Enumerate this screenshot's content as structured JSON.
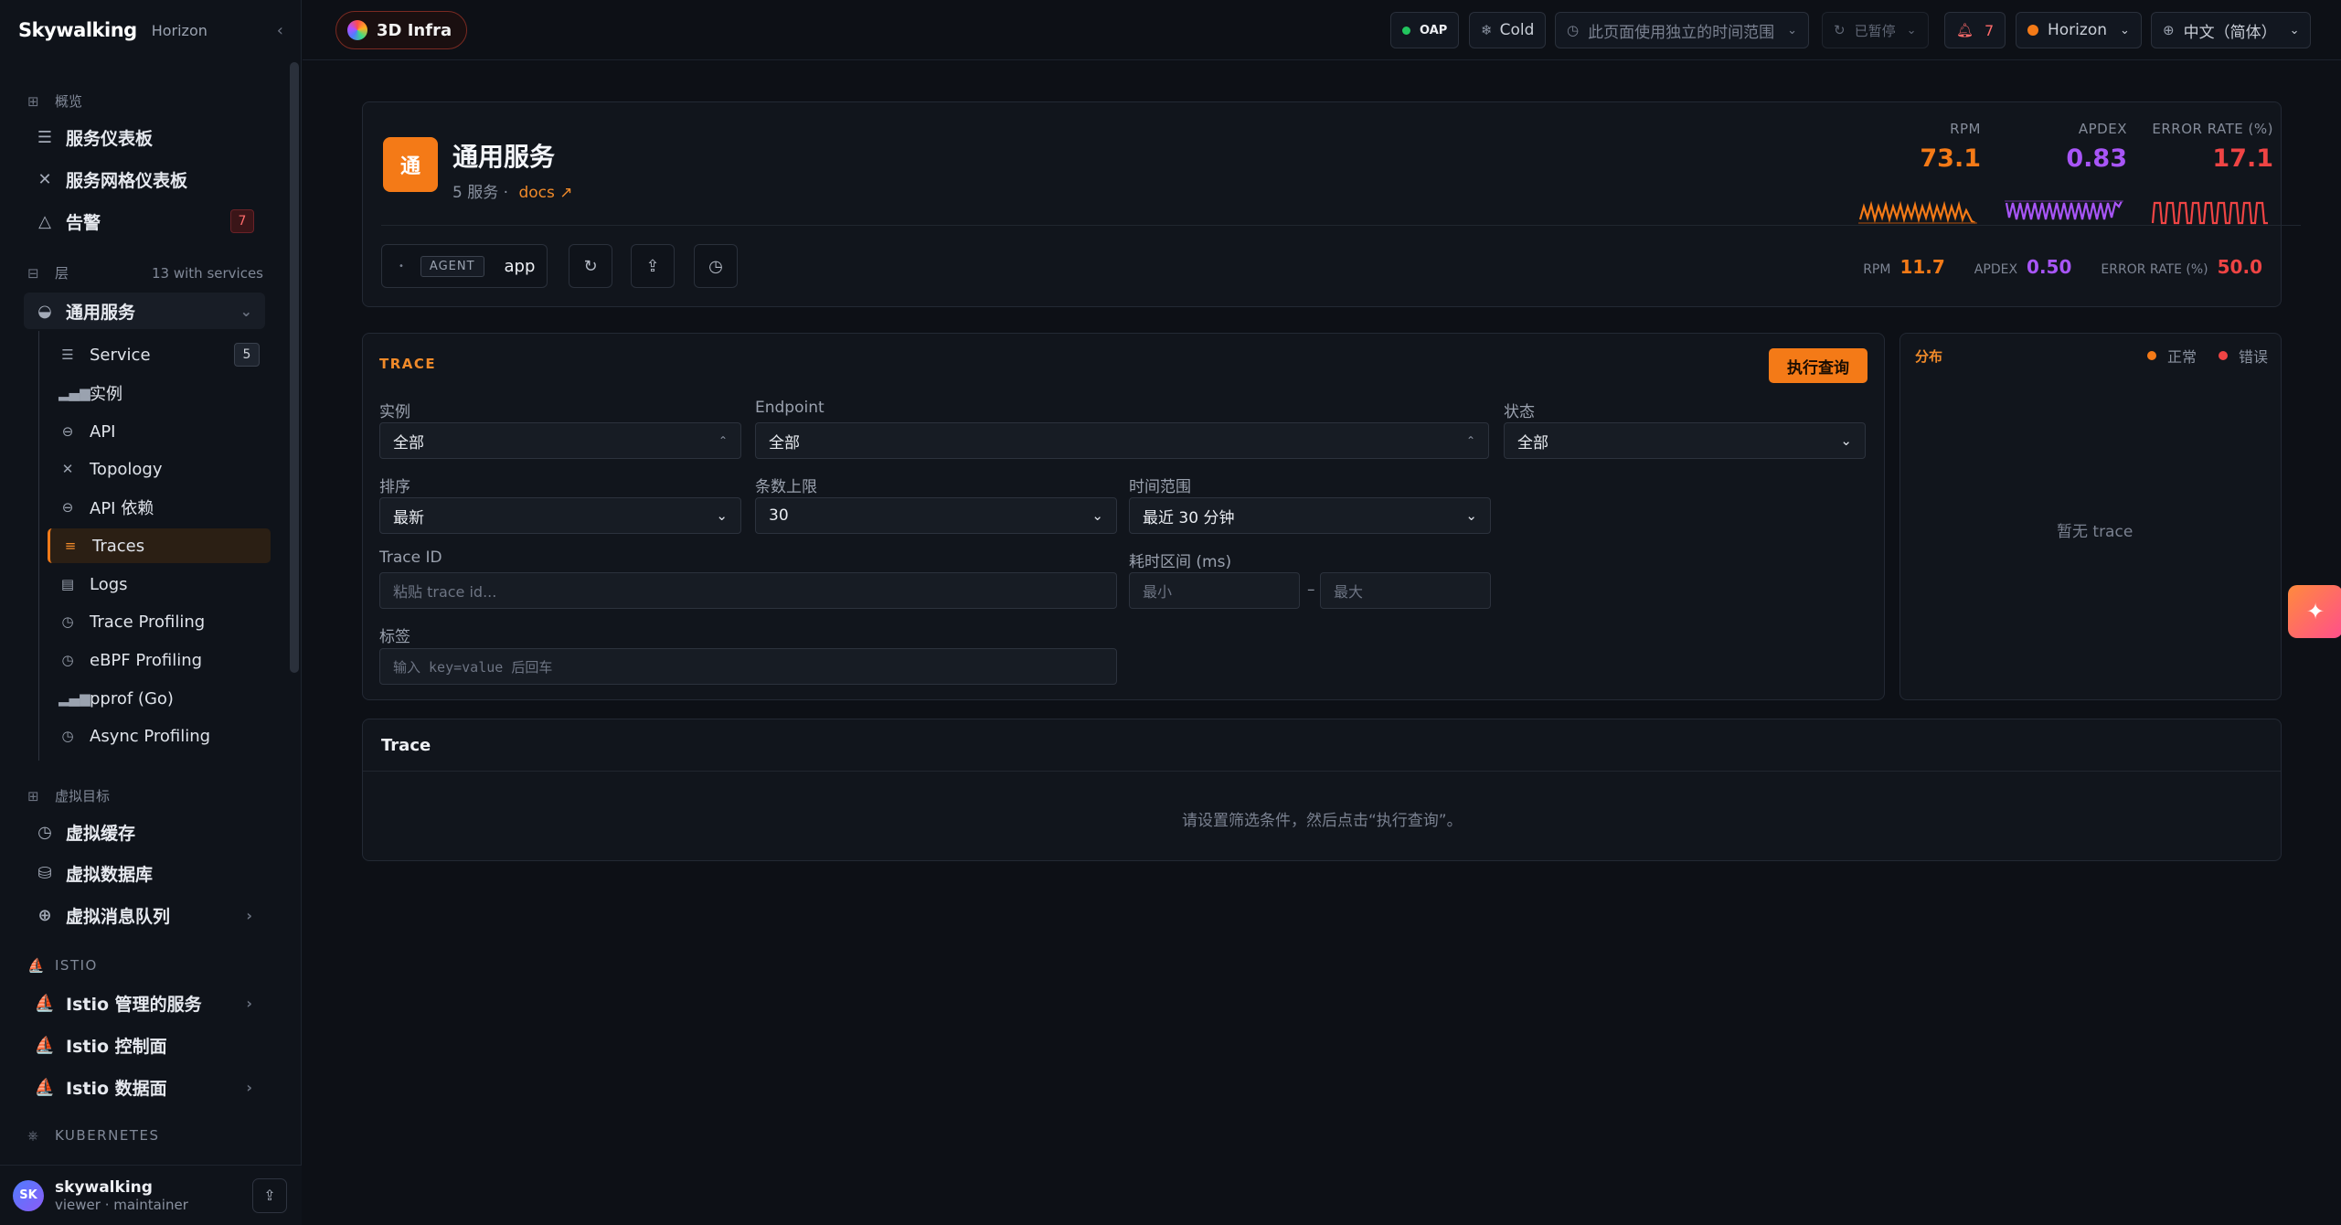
{
  "brand": {
    "logo": "Skywalking",
    "subtitle": "Horizon"
  },
  "sidebar": {
    "overview_header": "概览",
    "overview_items": [
      {
        "label": "服务仪表板"
      },
      {
        "label": "服务网格仪表板"
      },
      {
        "label": "告警",
        "badge": "7"
      }
    ],
    "layer_header": "层",
    "layer_meta": "13 with services",
    "active_group": "通用服务",
    "sub_items": [
      {
        "label": "Service",
        "count": "5"
      },
      {
        "label": "实例"
      },
      {
        "label": "API"
      },
      {
        "label": "Topology"
      },
      {
        "label": "API 依赖"
      },
      {
        "label": "Traces"
      },
      {
        "label": "Logs"
      },
      {
        "label": "Trace Profiling"
      },
      {
        "label": "eBPF Profiling"
      },
      {
        "label": "pprof (Go)"
      },
      {
        "label": "Async Profiling"
      }
    ],
    "virtual_header": "虚拟目标",
    "virtual_items": [
      {
        "label": "虚拟缓存"
      },
      {
        "label": "虚拟数据库"
      },
      {
        "label": "虚拟消息队列"
      }
    ],
    "istio_header": "ISTIO",
    "istio_items": [
      {
        "label": "Istio 管理的服务"
      },
      {
        "label": "Istio 控制面"
      },
      {
        "label": "Istio 数据面"
      }
    ],
    "k8s_header": "KUBERNETES"
  },
  "user": {
    "avatar": "SK",
    "name": "skywalking",
    "role": "viewer · maintainer"
  },
  "topbar": {
    "infra": "3D Infra",
    "oap": "OAP",
    "cold": "Cold",
    "time_range": "此页面使用独立的时间范围",
    "paused": "已暂停",
    "alerts": "7",
    "theme": "Horizon",
    "language": "中文（简体）"
  },
  "service": {
    "icon": "通",
    "title": "通用服务",
    "count_text": "5 服务 ·",
    "docs": "docs ↗",
    "metrics": [
      {
        "label": "RPM",
        "value": "73.1",
        "color": "#f47a17"
      },
      {
        "label": "APDEX",
        "value": "0.83",
        "color": "#a855f7"
      },
      {
        "label": "ERROR RATE (%)",
        "value": "17.1",
        "color": "#ef4444"
      }
    ],
    "agent_tag": "AGENT",
    "agent_value": "app",
    "mini": [
      {
        "label": "RPM",
        "value": "11.7"
      },
      {
        "label": "APDEX",
        "value": "0.50"
      },
      {
        "label": "ERROR RATE (%)",
        "value": "50.0"
      }
    ]
  },
  "trace_form": {
    "section": "TRACE",
    "run": "执行查询",
    "instance_label": "实例",
    "instance_value": "全部",
    "endpoint_label": "Endpoint",
    "endpoint_value": "全部",
    "status_label": "状态",
    "status_value": "全部",
    "sort_label": "排序",
    "sort_value": "最新",
    "limit_label": "条数上限",
    "limit_value": "30",
    "range_label": "时间范围",
    "range_value": "最近 30 分钟",
    "traceid_label": "Trace ID",
    "traceid_placeholder": "粘贴 trace id...",
    "duration_label": "耗时区间 (ms)",
    "duration_min": "最小",
    "duration_dash": "–",
    "duration_max": "最大",
    "tags_label": "标签",
    "tags_placeholder": "输入 key=value 后回车"
  },
  "distribution": {
    "title": "分布",
    "legend_normal": "正常",
    "legend_error": "错误",
    "legend_normal_color": "#f47a17",
    "legend_error_color": "#ef4444",
    "empty": "暂无 trace"
  },
  "results": {
    "title": "Trace",
    "empty": "请设置筛选条件，然后点击“执行查询”。"
  }
}
